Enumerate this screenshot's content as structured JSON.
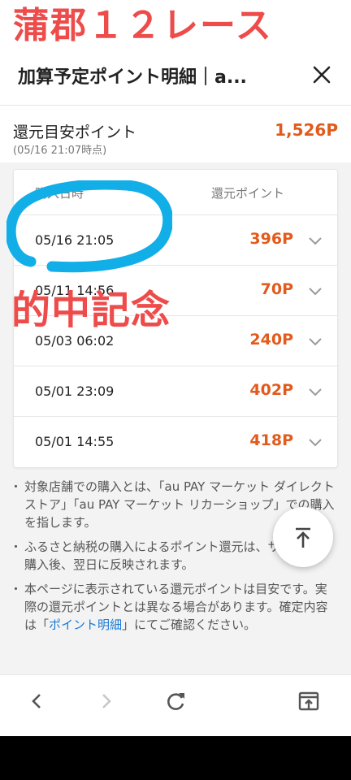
{
  "overlay": {
    "title": "蒲郡１２レース",
    "stamp": "的中記念"
  },
  "header": {
    "title": "加算予定ポイント明細｜a...",
    "close_icon": "close-icon"
  },
  "summary": {
    "label": "還元目安ポイント",
    "sub": "(05/16 21:07時点)",
    "value": "1,526P"
  },
  "table": {
    "headers": {
      "date": "購入日時",
      "points": "還元ポイント"
    },
    "rows": [
      {
        "date": "05/16 21:05",
        "points": "396P"
      },
      {
        "date": "05/11 14:56",
        "points": "70P"
      },
      {
        "date": "05/03 06:02",
        "points": "240P"
      },
      {
        "date": "05/01 23:09",
        "points": "402P"
      },
      {
        "date": "05/01 14:55",
        "points": "418P"
      }
    ]
  },
  "notes": {
    "n1": "対象店舗での購入とは、「au PAY マーケット ダイレクトストア」「au PAY マーケット リカーショップ」での購入を指します。",
    "n2": "ふるさと納税の購入によるポイント還元は、サービスご購入後、翌日に反映されます。",
    "n3_pre": "本ページに表示されている還元ポイントは目安です。実際の還元ポイントとは異なる場合があります。確定内容は「",
    "n3_link": "ポイント明細",
    "n3_post": "」にてご確認ください。"
  },
  "colors": {
    "accent": "#e25a1c",
    "overlay_red": "#ee4b4b",
    "annotation_blue": "#12aee8",
    "link": "#1a7ad9"
  },
  "icons": {
    "row_expand": "chevron-down-icon",
    "fab": "scroll-to-top-icon",
    "back": "back-arrow-icon",
    "forward": "forward-arrow-icon",
    "reload": "reload-icon",
    "tabs": "open-in-new-icon"
  }
}
